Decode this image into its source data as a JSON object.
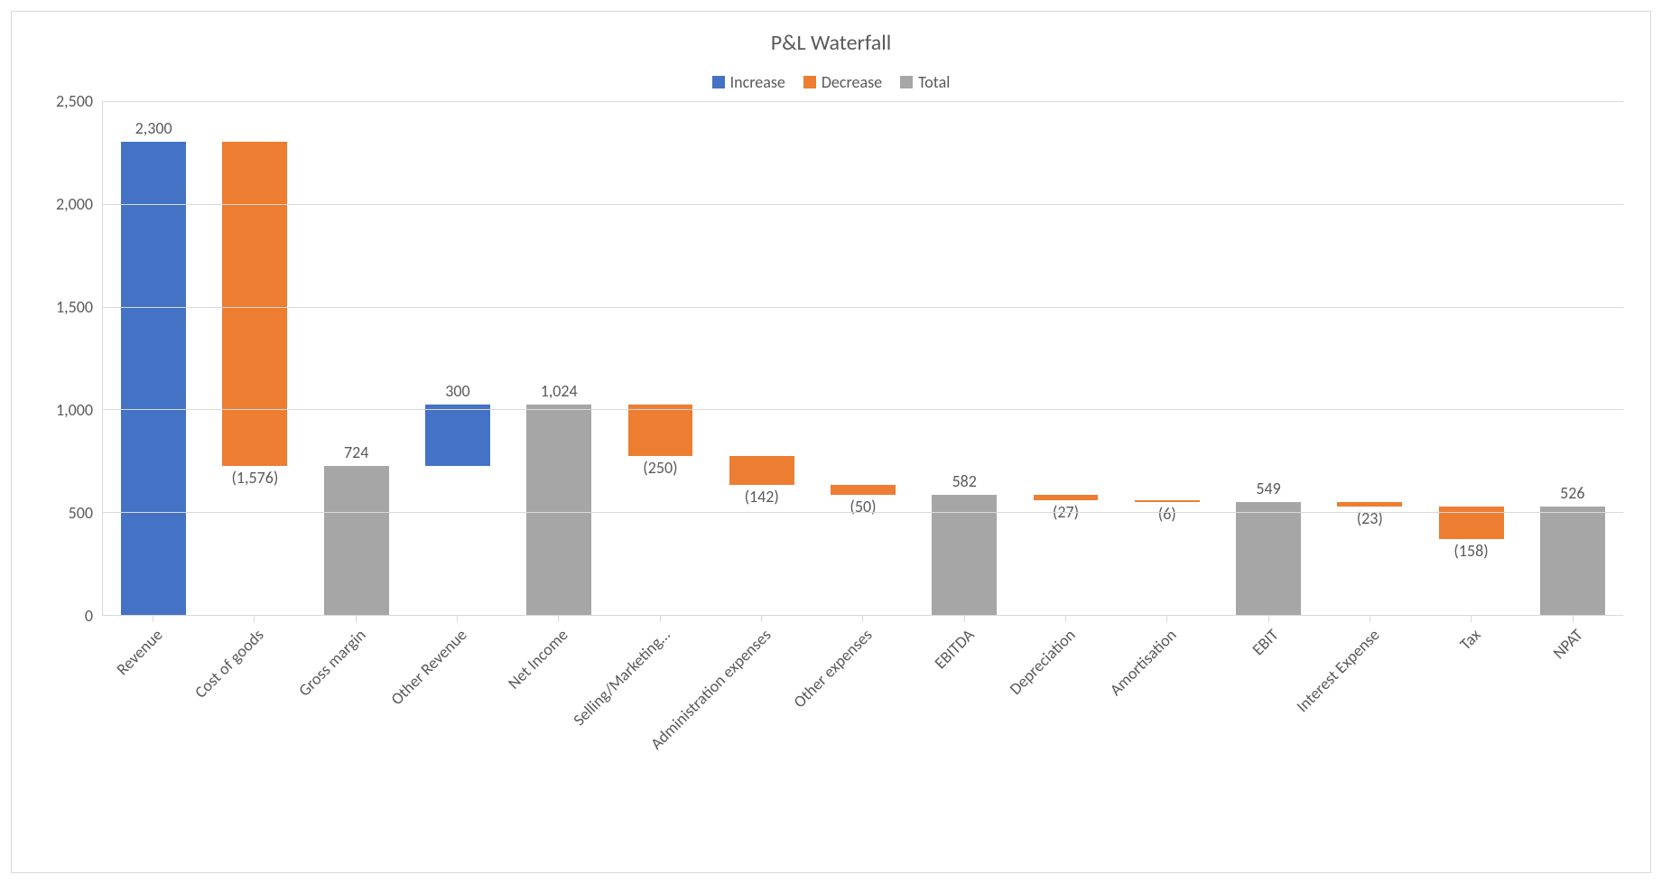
{
  "chart_data": {
    "type": "waterfall",
    "title": "P&L Waterfall",
    "ylabel": "",
    "xlabel": "",
    "ylim": [
      0,
      2500
    ],
    "y_ticks": [
      0,
      500,
      1000,
      1500,
      2000,
      2500
    ],
    "y_tick_labels": [
      "0",
      "500",
      "1,000",
      "1,500",
      "2,000",
      "2,500"
    ],
    "legend": {
      "increase": "Increase",
      "decrease": "Decrease",
      "total": "Total"
    },
    "colors": {
      "increase": "#4472c4",
      "decrease": "#ed7d31",
      "total": "#a6a6a6"
    },
    "items": [
      {
        "category": "Revenue",
        "label": "2,300",
        "value": 2300,
        "type": "increase",
        "start": 0,
        "end": 2300
      },
      {
        "category": "Cost of goods",
        "label": "(1,576)",
        "value": -1576,
        "type": "decrease",
        "start": 2300,
        "end": 724
      },
      {
        "category": "Gross margin",
        "label": "724",
        "value": 724,
        "type": "total",
        "start": 0,
        "end": 724
      },
      {
        "category": "Other Revenue",
        "label": "300",
        "value": 300,
        "type": "increase",
        "start": 724,
        "end": 1024
      },
      {
        "category": "Net Income",
        "label": "1,024",
        "value": 1024,
        "type": "total",
        "start": 0,
        "end": 1024
      },
      {
        "category": "Selling/Marketing…",
        "label": "(250)",
        "value": -250,
        "type": "decrease",
        "start": 1024,
        "end": 774
      },
      {
        "category": "Administration expenses",
        "label": "(142)",
        "value": -142,
        "type": "decrease",
        "start": 774,
        "end": 632
      },
      {
        "category": "Other expenses",
        "label": "(50)",
        "value": -50,
        "type": "decrease",
        "start": 632,
        "end": 582
      },
      {
        "category": "EBITDA",
        "label": "582",
        "value": 582,
        "type": "total",
        "start": 0,
        "end": 582
      },
      {
        "category": "Depreciation",
        "label": "(27)",
        "value": -27,
        "type": "decrease",
        "start": 582,
        "end": 555
      },
      {
        "category": "Amortisation",
        "label": "(6)",
        "value": -6,
        "type": "decrease",
        "start": 555,
        "end": 549
      },
      {
        "category": "EBIT",
        "label": "549",
        "value": 549,
        "type": "total",
        "start": 0,
        "end": 549
      },
      {
        "category": "Interest Expense",
        "label": "(23)",
        "value": -23,
        "type": "decrease",
        "start": 549,
        "end": 526
      },
      {
        "category": "Tax",
        "label": "(158)",
        "value": -158,
        "type": "decrease",
        "start": 526,
        "end": 368
      },
      {
        "category": "NPAT",
        "label": "526",
        "value": 526,
        "type": "total",
        "start": 0,
        "end": 526
      }
    ]
  }
}
